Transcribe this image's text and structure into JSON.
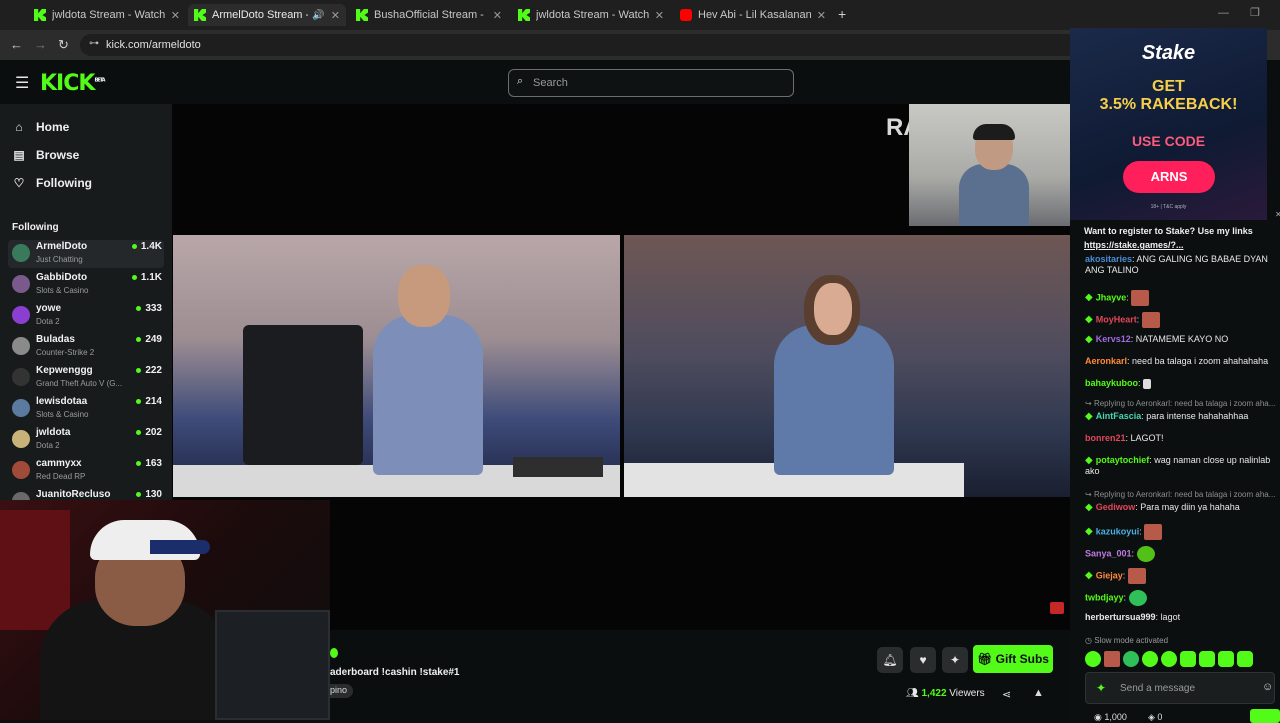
{
  "tabs": [
    {
      "title": "jwldota Stream - Watch Live on Kick",
      "icon": "kick"
    },
    {
      "title": "ArmelDoto Stream - Watch Live on Kick",
      "icon": "kick"
    },
    {
      "title": "BushaOfficial Stream - Watch Live on Kick",
      "icon": "kick"
    },
    {
      "title": "jwldota Stream - Watch Live on Kick",
      "icon": "kick"
    },
    {
      "title": "Hev Abi - Lil Kasalanan Shorties",
      "icon": "youtube"
    }
  ],
  "address": {
    "url": "kick.com/armeldoto"
  },
  "header": {
    "logo": "KICK",
    "logo_badge": "BETA",
    "search_placeholder": "Search"
  },
  "nav": [
    {
      "label": "Home",
      "icon": "home-icon"
    },
    {
      "label": "Browse",
      "icon": "browse-icon"
    },
    {
      "label": "Following",
      "icon": "heart-icon"
    }
  ],
  "following_title": "Following",
  "channels": [
    {
      "name": "ArmelDoto",
      "category": "Just Chatting",
      "viewers": "1.4K",
      "color": "#3a7a5c"
    },
    {
      "name": "GabbiDoto",
      "category": "Slots & Casino",
      "viewers": "1.1K",
      "color": "#7a5a8c"
    },
    {
      "name": "yowe",
      "category": "Dota 2",
      "viewers": "333",
      "color": "#8a3fd1"
    },
    {
      "name": "Buladas",
      "category": "Counter-Strike 2",
      "viewers": "249",
      "color": "#8a8a8a"
    },
    {
      "name": "Kepwenggg",
      "category": "Grand Theft Auto V (G...",
      "viewers": "222",
      "color": "#333333"
    },
    {
      "name": "lewisdotaa",
      "category": "Slots & Casino",
      "viewers": "214",
      "color": "#5a7aa0"
    },
    {
      "name": "jwldota",
      "category": "Dota 2",
      "viewers": "202",
      "color": "#c9b27a"
    },
    {
      "name": "cammyxx",
      "category": "Red Dead RP",
      "viewers": "163",
      "color": "#a04a3a"
    },
    {
      "name": "JuanitoRecluso",
      "category": "",
      "viewers": "130",
      "color": "#6a6a6a"
    }
  ],
  "stream": {
    "overlay_text": "RA",
    "title_fragment": "aderboard !cashin !stake#1",
    "tag_fragment": "pino",
    "viewers": "1,422",
    "viewers_label": "Viewers",
    "gift_label": "Gift Subs"
  },
  "ad": {
    "brand": "Stake",
    "line1": "GET",
    "line2": "3.5% RAKEBACK!",
    "code_label": "USE CODE",
    "code": "ARNS",
    "fine_print": "18+ | T&C apply"
  },
  "pinned": {
    "text": "Want to register to Stake? Use my links",
    "link": "https://stake.games/?..."
  },
  "chat": [
    {
      "user": "akositaries",
      "color": "#4a8bd4",
      "gem": false,
      "text": "ANG GALING NG BABAE DYAN",
      "text2": "ANG TALINO"
    },
    {
      "user": "Jhayve",
      "color": "#53fc18",
      "gem": true,
      "text": "",
      "emote": "#b85a4a"
    },
    {
      "user": "MoyHeart",
      "color": "#e0475a",
      "gem": true,
      "text": "",
      "emote": "#b85a4a"
    },
    {
      "user": "Kervs12",
      "color": "#a06be0",
      "gem": true,
      "text": "NATAMEME KAYO NO"
    },
    {
      "user": "Aeronkarl",
      "color": "#ff8a3a",
      "gem": false,
      "text": "need ba talaga i zoom ahahahaha"
    },
    {
      "user": "bahaykuboo",
      "color": "#53fc18",
      "gem": false,
      "text": "",
      "emote": "#dddddd"
    },
    {
      "reply": "Replying to Aeronkarl: need ba talaga i zoom aha..."
    },
    {
      "user": "AintFascia",
      "color": "#4ad4b0",
      "gem": true,
      "text": "para intense hahahahhaa"
    },
    {
      "user": "bonren21",
      "color": "#e0475a",
      "gem": false,
      "text": "LAGOT!"
    },
    {
      "user": "potaytochief",
      "color": "#53fc18",
      "gem": true,
      "text": "wag naman close up nalinlab",
      "text2": "ako"
    },
    {
      "reply": "Replying to Aeronkarl: need ba talaga i zoom aha..."
    },
    {
      "user": "Gediwow",
      "color": "#e0475a",
      "gem": true,
      "text": "Para may diin ya hahaha"
    },
    {
      "user": "kazukoyui",
      "color": "#4ab0e0",
      "gem": true,
      "text": "",
      "emote": "#b85a4a"
    },
    {
      "user": "Sanya_001",
      "color": "#c07ae0",
      "gem": false,
      "text": "",
      "emote": "#53c018"
    },
    {
      "user": "Giejay",
      "color": "#ff8a3a",
      "gem": true,
      "text": "",
      "emote": "#b85a4a"
    },
    {
      "user": "twbdjayy",
      "color": "#53fc18",
      "gem": false,
      "text": "",
      "emote": "#2fc05a"
    },
    {
      "user": "herbertursua999",
      "color": "#e8e8e8",
      "gem": false,
      "text": "lagot"
    }
  ],
  "slow_mode": "Slow mode activated",
  "send_placeholder": "Send a message",
  "chat_footer": {
    "count1": "1,000",
    "count2": "0"
  }
}
